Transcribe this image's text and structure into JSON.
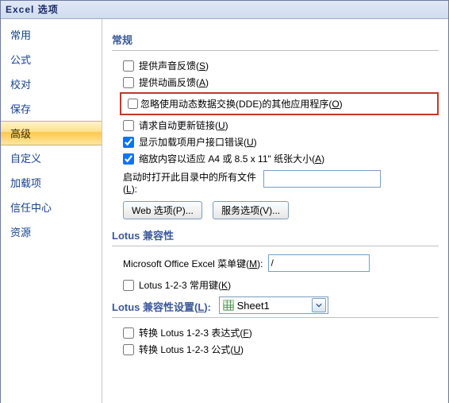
{
  "title": "Excel 选项",
  "sidebar": {
    "items": [
      {
        "label": "常用"
      },
      {
        "label": "公式"
      },
      {
        "label": "校对"
      },
      {
        "label": "保存"
      },
      {
        "label": "高级"
      },
      {
        "label": "自定义"
      },
      {
        "label": "加载项"
      },
      {
        "label": "信任中心"
      },
      {
        "label": "资源"
      }
    ],
    "selected_index": 4
  },
  "sections": {
    "general": {
      "header": "常规",
      "sound": {
        "label": "提供声音反馈(",
        "hotkey": "S",
        "label_end": ")",
        "checked": false
      },
      "anim": {
        "label": "提供动画反馈(",
        "hotkey": "A",
        "label_end": ")",
        "checked": false
      },
      "dde": {
        "label": "忽略使用动态数据交换(DDE)的其他应用程序(",
        "hotkey": "O",
        "label_end": ")",
        "checked": false
      },
      "autolink": {
        "label": "请求自动更新链接(",
        "hotkey": "U",
        "label_end": ")",
        "checked": false
      },
      "addinerr": {
        "label": "显示加载项用户接口错误(",
        "hotkey": "U",
        "label_end": ")",
        "checked": true
      },
      "scale": {
        "label": "缩放内容以适应 A4 或 8.5 x 11\" 纸张大小(",
        "hotkey": "A",
        "label_end": ")",
        "checked": true
      },
      "startup_label_a": "启动时打开此目录中的所有文件",
      "startup_label_b": "(",
      "startup_hotkey": "L",
      "startup_label_c": "):",
      "startup_value": "",
      "btn_web": "Web 选项(P)...",
      "btn_svc": "服务选项(V)..."
    },
    "lotus1": {
      "header": "Lotus 兼容性",
      "menu_label": "Microsoft Office Excel 菜单键(",
      "menu_hotkey": "M",
      "menu_label_end": "):",
      "menu_value": "/",
      "commonkeys": {
        "label": "Lotus 1-2-3 常用键(",
        "hotkey": "K",
        "label_end": ")",
        "checked": false
      }
    },
    "lotus2": {
      "header": "Lotus 兼容性设置(",
      "header_hotkey": "L",
      "header_end": "):",
      "sheet_selected": "Sheet1",
      "exprs": {
        "label": "转换 Lotus 1-2-3 表达式(",
        "hotkey": "F",
        "label_end": ")",
        "checked": false
      },
      "forms": {
        "label": "转换 Lotus 1-2-3 公式(",
        "hotkey": "U",
        "label_end": ")",
        "checked": false
      }
    }
  }
}
